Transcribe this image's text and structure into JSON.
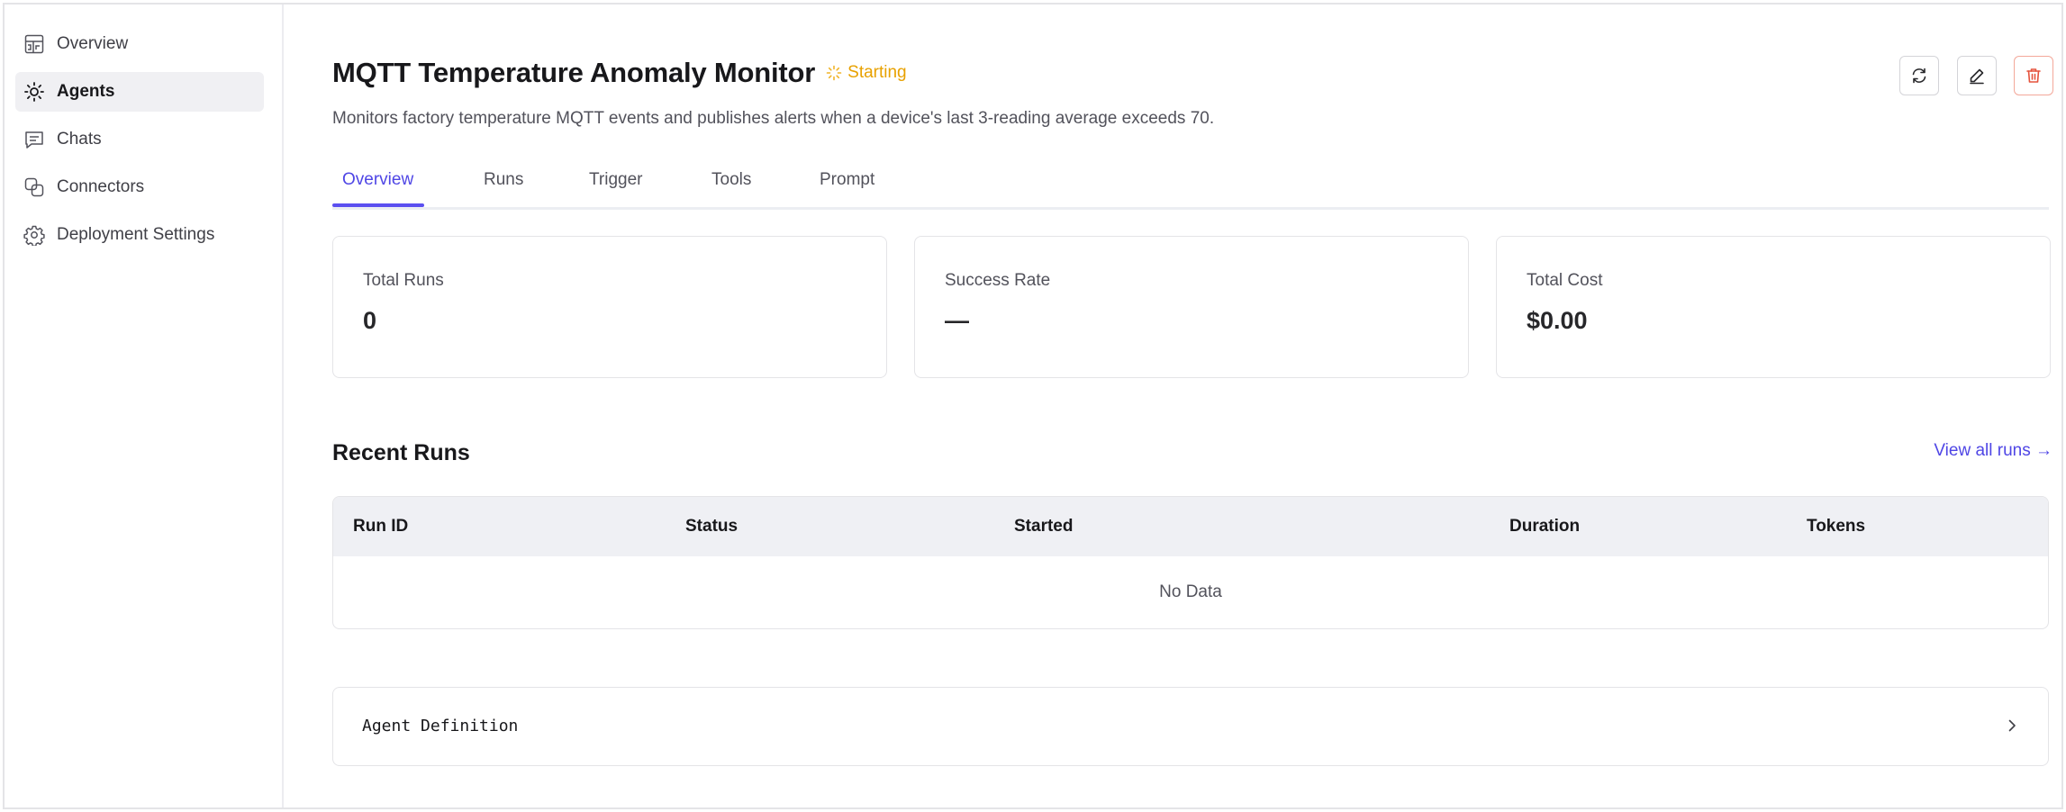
{
  "sidebar": {
    "items": [
      {
        "label": "Overview",
        "icon": "dashboard-icon",
        "active": false
      },
      {
        "label": "Agents",
        "icon": "sun-icon",
        "active": true
      },
      {
        "label": "Chats",
        "icon": "chat-icon",
        "active": false
      },
      {
        "label": "Connectors",
        "icon": "connector-icon",
        "active": false
      },
      {
        "label": "Deployment Settings",
        "icon": "gear-icon",
        "active": false
      }
    ]
  },
  "header": {
    "title": "MQTT Temperature Anomaly Monitor",
    "status": "Starting",
    "status_color": "#e8a100",
    "description": "Monitors factory temperature MQTT events and publishes alerts when a device's last 3-reading average exceeds 70.",
    "actions": [
      "refresh-icon",
      "edit-icon",
      "trash-icon"
    ]
  },
  "tabs": [
    {
      "label": "Overview",
      "active": true
    },
    {
      "label": "Runs",
      "active": false
    },
    {
      "label": "Trigger",
      "active": false
    },
    {
      "label": "Tools",
      "active": false
    },
    {
      "label": "Prompt",
      "active": false
    }
  ],
  "stats": [
    {
      "label": "Total Runs",
      "value": "0"
    },
    {
      "label": "Success Rate",
      "value": "—"
    },
    {
      "label": "Total Cost",
      "value": "$0.00"
    }
  ],
  "recent_runs": {
    "title": "Recent Runs",
    "view_all": "View all runs →",
    "columns": [
      "Run ID",
      "Status",
      "Started",
      "Duration",
      "Tokens"
    ],
    "empty_text": "No Data"
  },
  "definition": {
    "label": "Agent Definition"
  },
  "colors": {
    "accent": "#4f46e5",
    "danger": "#e5533d"
  }
}
